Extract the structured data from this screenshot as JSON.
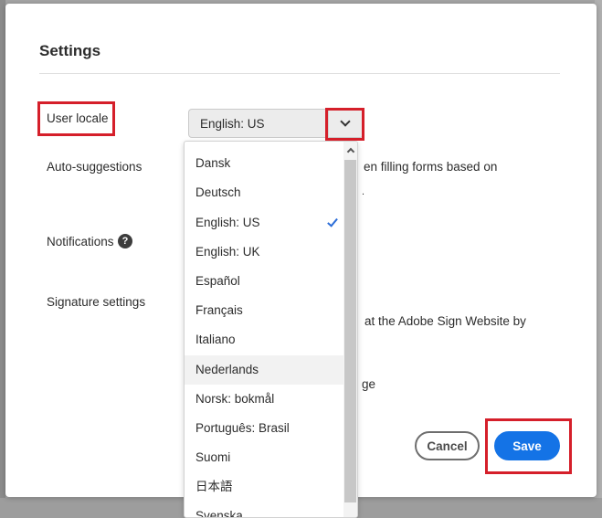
{
  "dialog": {
    "title": "Settings",
    "buttons": {
      "cancel": "Cancel",
      "save": "Save"
    }
  },
  "settings": {
    "user_locale_label": "User locale",
    "auto_suggestions_label": "Auto-suggestions",
    "notifications_label": "Notifications",
    "signature_settings_label": "Signature settings"
  },
  "locale_select": {
    "value": "English: US",
    "selected_option": "English: US",
    "hovered_option": "Nederlands",
    "options": [
      "Dansk",
      "Deutsch",
      "English: US",
      "English: UK",
      "Español",
      "Français",
      "Italiano",
      "Nederlands",
      "Norsk: bokmål",
      "Português: Brasil",
      "Suomi",
      "日本語",
      "Svenska"
    ]
  },
  "obscured_text": {
    "auto_suggestions_partial": "en filling forms based on",
    "signature_partial": "at the Adobe Sign Website by",
    "signature_partial_2": "ge"
  },
  "colors": {
    "accent": "#1473e6",
    "highlight": "#d51f2a",
    "check": "#2b6dd8"
  }
}
